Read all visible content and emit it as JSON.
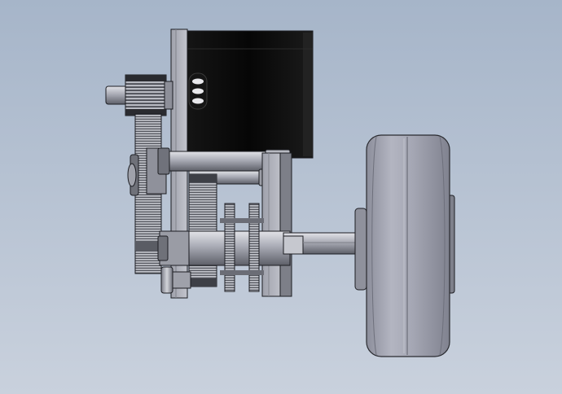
{
  "viewport": {
    "background_top": "#a6b5c9",
    "background_bottom": "#c9d1dd"
  },
  "model": {
    "parts": [
      "motor-housing",
      "motor-mount-plate",
      "pinion-gear",
      "input-spur-gear",
      "gearbox-side-plate",
      "upper-shaft",
      "lower-shaft",
      "intermediate-gear",
      "sprocket-pair",
      "axle",
      "wheel-hub",
      "wheel-tire"
    ],
    "colors": {
      "motor_body": "#0a0a0a",
      "metal_light": "#c4c6cf",
      "metal_mid": "#8d8f99",
      "metal_dark": "#4d4f57",
      "tire": "#9b9dab",
      "tire_edge": "#6e707c",
      "outline": "#1c1d22"
    }
  }
}
